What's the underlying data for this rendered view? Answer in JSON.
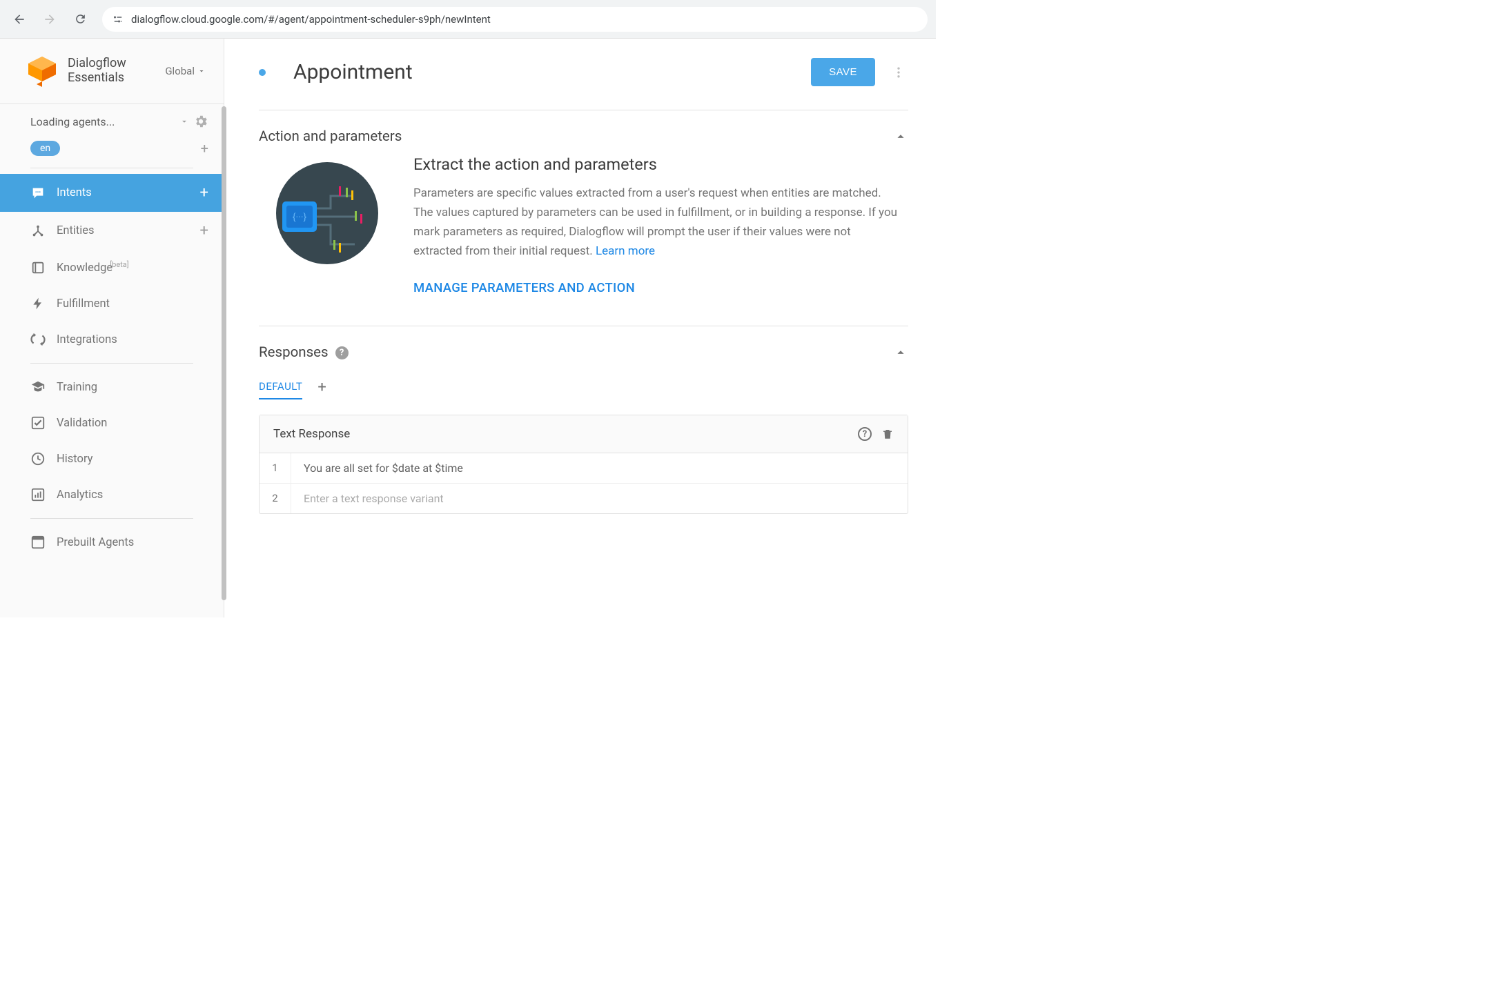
{
  "browser": {
    "url": "dialogflow.cloud.google.com/#/agent/appointment-scheduler-s9ph/newIntent"
  },
  "brand": {
    "line1": "Dialogflow",
    "line2": "Essentials",
    "region": "Global"
  },
  "sidebar": {
    "agent_loading": "Loading agents...",
    "lang_pill": "en",
    "items": {
      "intents": "Intents",
      "entities": "Entities",
      "knowledge": "Knowledge",
      "knowledge_badge": "[beta]",
      "fulfillment": "Fulfillment",
      "integrations": "Integrations",
      "training": "Training",
      "validation": "Validation",
      "history": "History",
      "analytics": "Analytics",
      "prebuilt": "Prebuilt Agents"
    }
  },
  "header": {
    "title": "Appointment",
    "save": "SAVE"
  },
  "action_params": {
    "section_title": "Action and parameters",
    "heading": "Extract the action and parameters",
    "desc": "Parameters are specific values extracted from a user's request when entities are matched. The values captured by parameters can be used in fulfillment, or in building a response. If you mark parameters as required, Dialogflow will prompt the user if their values were not extracted from their initial request. ",
    "learn_more": "Learn more",
    "manage_link": "MANAGE PARAMETERS AND ACTION"
  },
  "responses": {
    "section_title": "Responses",
    "tab_default": "DEFAULT",
    "card_title": "Text Response",
    "rows": [
      {
        "n": "1",
        "text": "You are all set for $date at $time",
        "placeholder": false
      },
      {
        "n": "2",
        "text": "Enter a text response variant",
        "placeholder": true
      }
    ]
  }
}
